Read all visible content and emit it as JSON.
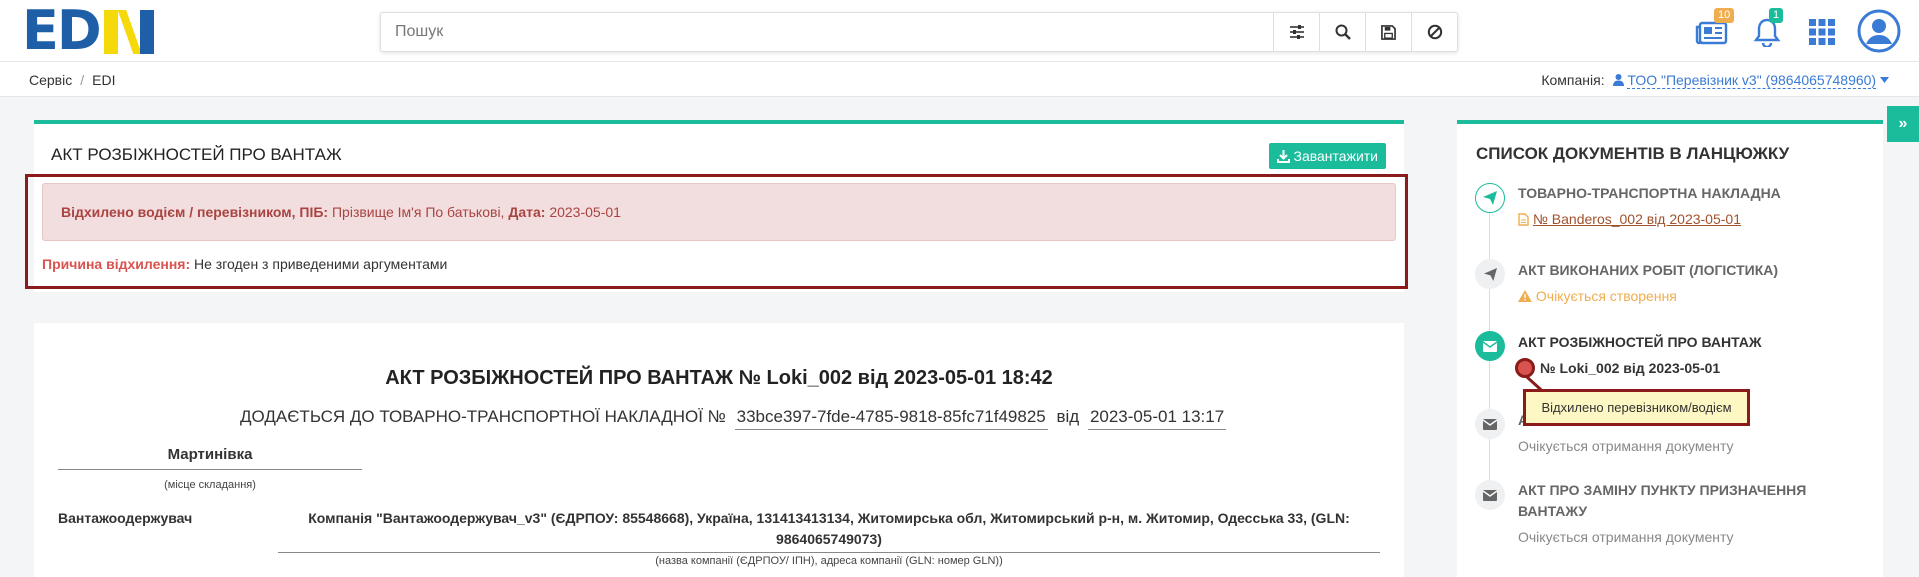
{
  "header": {
    "logo_text": "EDIN",
    "search_placeholder": "Пошук",
    "icons": [
      "filter-settings-icon",
      "search-icon",
      "save-icon",
      "cancel-icon"
    ],
    "news_badge": "10",
    "notifications_badge": "1"
  },
  "breadcrumb": {
    "items": [
      "Сервіс",
      "EDI"
    ]
  },
  "company": {
    "label": "Компанія:",
    "value": "ТОО \"Перевізник v3\" (9864065748960)"
  },
  "main": {
    "title": "АКТ РОЗБІЖНОСТЕЙ ПРО ВАНТАЖ",
    "download_label": "Завантажити",
    "reject": {
      "who_label": "Відхилено водієм / перевізником, ПІБ:",
      "who_value": "Прізвище Ім'я По батькові,",
      "date_label": "Дата:",
      "date_value": "2023-05-01",
      "reason_label": "Причина відхилення:",
      "reason_value": "Не згоден з приведеними аргументами"
    },
    "doc": {
      "title": "АКТ РОЗБІЖНОСТЕЙ ПРО ВАНТАЖ № Loki_002 від 2023-05-01 18:42",
      "attach_prefix": "ДОДАЄТЬСЯ ДО ТОВАРНО-ТРАНСПОРТНОЇ НАКЛАДНОЇ №",
      "attach_number": "33bce397-7fde-4785-9818-85fc71f49825",
      "attach_from": "від",
      "attach_date": "2023-05-01 13:17",
      "place": "Мартинівка",
      "place_caption": "(місце складання)",
      "receiver_label": "Вантажоодержувач",
      "receiver_value": "Компанія \"Вантажоодержувач_v3\" (ЄДРПОУ: 85548668), Україна, 131413413134, Житомирська обл, Житомирський р-н, м. Житомир, Одесська 33, (GLN: 9864065749073)",
      "receiver_caption": "(назва компанії (ЄДРПОУ/ ІПН), адреса компанії (GLN: номер GLN))"
    }
  },
  "chain": {
    "title": "СПИСОК ДОКУМЕНТІВ В ЛАНЦЮЖКУ",
    "items": [
      {
        "title": "ТОВАРНО-ТРАНСПОРТНА НАКЛАДНА",
        "sub": " № Banderos_002 від 2023-05-01",
        "icon": "paper-plane-icon"
      },
      {
        "title": "АКТ ВИКОНАНИХ РОБІТ (ЛОГІСТИКА)",
        "sub": "Очікується створення",
        "icon": "paper-plane-icon"
      },
      {
        "title": "АКТ РОЗБІЖНОСТЕЙ ПРО ВАНТАЖ",
        "sub": "№ Loki_002 від 2023-05-01",
        "icon": "envelope-icon"
      },
      {
        "title": "А",
        "sub": "Очікується отримання документу",
        "icon": "envelope-icon"
      },
      {
        "title": "АКТ ПРО ЗАМІНУ ПУНКТУ ПРИЗНАЧЕННЯ",
        "title2": "ВАНТАЖУ",
        "sub": "Очікується отримання документу",
        "icon": "envelope-icon"
      }
    ],
    "tooltip": "Відхилено перевізником/водієм"
  },
  "colors": {
    "accent": "#1abc9c",
    "brand_blue": "#1e5fa8",
    "brand_yellow": "#f5d90a",
    "highlight_border": "#8b1a1a",
    "alert_bg": "#f2dede"
  }
}
